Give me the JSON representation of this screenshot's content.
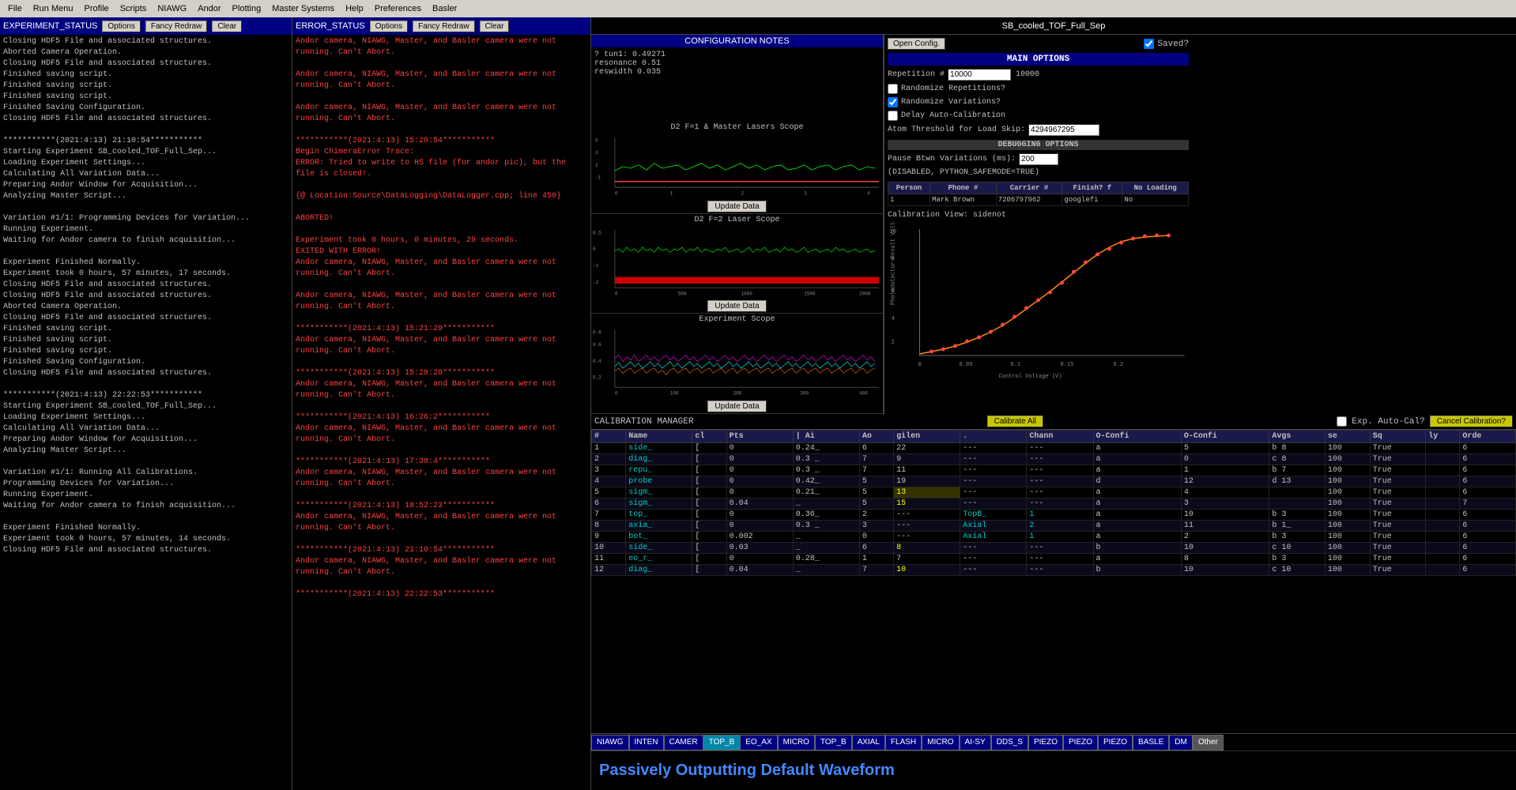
{
  "menubar": {
    "items": [
      "File",
      "Run Menu",
      "Profile",
      "Scripts",
      "NIAWG",
      "Andor",
      "Plotting",
      "Master Systems",
      "Help",
      "Preferences",
      "Basler"
    ]
  },
  "experiment_panel": {
    "title": "EXPERIMENT_STATUS",
    "options_btn": "Options",
    "fancy_btn": "Fancy Redraw",
    "clear_btn": "Clear",
    "logs": [
      {
        "text": "Closing HDF5 File and associated structures.",
        "cls": "normal"
      },
      {
        "text": "Aborted Camera Operation.",
        "cls": "normal"
      },
      {
        "text": "Closing HDF5 File and associated structures.",
        "cls": "normal"
      },
      {
        "text": "Finished saving script.",
        "cls": "normal"
      },
      {
        "text": "Finished saving script.",
        "cls": "normal"
      },
      {
        "text": "Finished saving script.",
        "cls": "normal"
      },
      {
        "text": "Finished Saving Configuration.",
        "cls": "normal"
      },
      {
        "text": "Closing HDF5 File and associated structures.",
        "cls": "normal"
      },
      {
        "text": "",
        "cls": "normal"
      },
      {
        "text": "***********(2021:4:13) 21:10:54***********",
        "cls": "normal"
      },
      {
        "text": "Starting Experiment SB_cooled_TOF_Full_Sep...",
        "cls": "normal"
      },
      {
        "text": "Loading Experiment Settings...",
        "cls": "normal"
      },
      {
        "text": "Calculating All Variation Data...",
        "cls": "normal"
      },
      {
        "text": "Preparing Andor Window for Acquisition...",
        "cls": "normal"
      },
      {
        "text": "Analyzing Master Script...",
        "cls": "normal"
      },
      {
        "text": "",
        "cls": "normal"
      },
      {
        "text": "Variation #1/1: Programming Devices for Variation...",
        "cls": "normal"
      },
      {
        "text": "Running Experiment.",
        "cls": "normal"
      },
      {
        "text": "Waiting for Andor camera to finish acquisition...",
        "cls": "normal"
      },
      {
        "text": "",
        "cls": "normal"
      },
      {
        "text": "Experiment Finished Normally.",
        "cls": "normal"
      },
      {
        "text": "Experiment took 0 hours, 57 minutes, 17 seconds.",
        "cls": "normal"
      },
      {
        "text": "Closing HDF5 File and associated structures.",
        "cls": "normal"
      },
      {
        "text": "Closing HDF5 File and associated structures.",
        "cls": "normal"
      },
      {
        "text": "Aborted Camera Operation.",
        "cls": "normal"
      },
      {
        "text": "Closing HDF5 File and associated structures.",
        "cls": "normal"
      },
      {
        "text": "Finished saving script.",
        "cls": "normal"
      },
      {
        "text": "Finished saving script.",
        "cls": "normal"
      },
      {
        "text": "Finished saving script.",
        "cls": "normal"
      },
      {
        "text": "Finished Saving Configuration.",
        "cls": "normal"
      },
      {
        "text": "Closing HDF5 File and associated structures.",
        "cls": "normal"
      },
      {
        "text": "",
        "cls": "normal"
      },
      {
        "text": "***********(2021:4:13) 22:22:53***********",
        "cls": "normal"
      },
      {
        "text": "Starting Experiment SB_cooled_TOF_Full_Sep...",
        "cls": "normal"
      },
      {
        "text": "Loading Experiment Settings...",
        "cls": "normal"
      },
      {
        "text": "Calculating All Variation Data...",
        "cls": "normal"
      },
      {
        "text": "Preparing Andor Window for Acquisition...",
        "cls": "normal"
      },
      {
        "text": "Analyzing Master Script...",
        "cls": "normal"
      },
      {
        "text": "",
        "cls": "normal"
      },
      {
        "text": "Variation #1/1: Running All Calibrations.",
        "cls": "normal"
      },
      {
        "text": "Programming Devices for Variation...",
        "cls": "normal"
      },
      {
        "text": "Running Experiment.",
        "cls": "normal"
      },
      {
        "text": "Waiting for Andor camera to finish acquisition...",
        "cls": "normal"
      },
      {
        "text": "",
        "cls": "normal"
      },
      {
        "text": "Experiment Finished Normally.",
        "cls": "normal"
      },
      {
        "text": "Experiment took 0 hours, 57 minutes, 14 seconds.",
        "cls": "normal"
      },
      {
        "text": "Closing HDF5 File and associated structures.",
        "cls": "normal"
      }
    ]
  },
  "error_panel": {
    "title": "ERROR_STATUS",
    "options_btn": "Options",
    "fancy_btn": "Fancy Redraw",
    "clear_btn": "Clear",
    "logs": [
      {
        "text": "Andor camera, NIAWG, Master, and Basler camera were not running. Can't Abort.",
        "cls": "error"
      },
      {
        "text": "",
        "cls": "normal"
      },
      {
        "text": "Andor camera, NIAWG, Master, and Basler camera were not running. Can't Abort.",
        "cls": "error"
      },
      {
        "text": "",
        "cls": "normal"
      },
      {
        "text": "Andor camera, NIAWG, Master, and Basler camera were not running. Can't Abort.",
        "cls": "error"
      },
      {
        "text": "",
        "cls": "normal"
      },
      {
        "text": "***********(2021:4:13) 15:20:54***********",
        "cls": "error"
      },
      {
        "text": "Begin ChimeraError Trace:",
        "cls": "error"
      },
      {
        "text": "ERROR: Tried to write to HS file (for andor pic), but the file is closed!.",
        "cls": "error"
      },
      {
        "text": "",
        "cls": "normal"
      },
      {
        "text": "{@ Location:Source\\DataLogging\\DataLogger.cpp; line 450}",
        "cls": "error"
      },
      {
        "text": "",
        "cls": "normal"
      },
      {
        "text": "ABORTED!",
        "cls": "error"
      },
      {
        "text": "",
        "cls": "normal"
      },
      {
        "text": "Experiment took 0 hours, 0 minutes, 29 seconds.",
        "cls": "error"
      },
      {
        "text": "EXITED WITH ERROR!",
        "cls": "error"
      },
      {
        "text": "Andor camera, NIAWG, Master, and Basler camera were not running. Can't Abort.",
        "cls": "error"
      },
      {
        "text": "",
        "cls": "normal"
      },
      {
        "text": "Andor camera, NIAWG, Master, and Basler camera were not running. Can't Abort.",
        "cls": "error"
      },
      {
        "text": "",
        "cls": "normal"
      },
      {
        "text": "***********(2021:4:13) 15:21:29***********",
        "cls": "error"
      },
      {
        "text": "Andor camera, NIAWG, Master, and Basler camera were not running. Can't Abort.",
        "cls": "error"
      },
      {
        "text": "",
        "cls": "normal"
      },
      {
        "text": "***********(2021:4:13) 15:28:28***********",
        "cls": "error"
      },
      {
        "text": "Andor camera, NIAWG, Master, and Basler camera were not running. Can't Abort.",
        "cls": "error"
      },
      {
        "text": "",
        "cls": "normal"
      },
      {
        "text": "***********(2021:4:13) 16:26:2***********",
        "cls": "error"
      },
      {
        "text": "Andor camera, NIAWG, Master, and Basler camera were not running. Can't Abort.",
        "cls": "error"
      },
      {
        "text": "",
        "cls": "normal"
      },
      {
        "text": "***********(2021:4:13) 17:38:4***********",
        "cls": "error"
      },
      {
        "text": "Andor camera, NIAWG, Master, and Basler camera were not running. Can't Abort.",
        "cls": "error"
      },
      {
        "text": "",
        "cls": "normal"
      },
      {
        "text": "***********(2021:4:13) 18:52:23***********",
        "cls": "error"
      },
      {
        "text": "Andor camera, NIAWG, Master, and Basler camera were not running. Can't Abort.",
        "cls": "error"
      },
      {
        "text": "",
        "cls": "normal"
      },
      {
        "text": "***********(2021:4:13) 21:10:54***********",
        "cls": "error"
      },
      {
        "text": "Andor camera, NIAWG, Master, and Basler camera were not running. Can't Abort.",
        "cls": "error"
      },
      {
        "text": "",
        "cls": "normal"
      },
      {
        "text": "***********(2021:4:13) 22:22:53***********",
        "cls": "error"
      }
    ]
  },
  "config_panel": {
    "title": "SB_cooled_TOF_Full_Sep",
    "notes_title": "CONFIGURATION NOTES",
    "notes": [
      "? tun1: 0.49271",
      "resonance 0.51",
      "reswidth 0.035"
    ],
    "plots": [
      {
        "title": "D2 F=1 & Master Lasers Scope",
        "update_btn": "Update Data"
      },
      {
        "title": "D2 F=2 Laser Scope",
        "update_btn": "Update Data"
      },
      {
        "title": "Experiment Scope",
        "update_btn": "Update Data"
      }
    ]
  },
  "options_panel": {
    "title": "MAIN OPTIONS",
    "open_config_btn": "Open Config.",
    "saved_label": "Saved?",
    "repetition_label": "Repetition #",
    "repetition_value": "10000",
    "repetition_display": "10000",
    "randomize_reps": "Randomize Repetitions?",
    "randomize_reps_checked": false,
    "randomize_vars": "Randomize Variations?",
    "randomize_vars_checked": true,
    "delay_autocal": "Delay Auto-Calibration",
    "delay_autocal_checked": false,
    "atom_threshold_label": "Atom Threshold for Load Skip:",
    "atom_threshold_value": "4294967295",
    "debug_title": "DEBUGGING OPTIONS",
    "pause_btwn_label": "Pause Btwn Variations (ms):",
    "pause_btwn_value": "200",
    "python_mode": "(DISABLED, PYTHON_SAFEMODE=TRUE)",
    "loading_table": {
      "headers": [
        "Person",
        "Phone #",
        "Carrier #",
        "Finish? f",
        "No Loading"
      ],
      "rows": [
        [
          "1",
          "Mark Brown",
          "7206797962",
          "googlefi",
          "No",
          "",
          "No"
        ]
      ]
    },
    "cal_view_label": "Calibration View: sidenot",
    "exp_autocal_label": "Exp. Auto-Cal?",
    "cancel_cal_btn": "Cancel Calibration?"
  },
  "calibration": {
    "manager_title": "CALIBRATION MANAGER",
    "calibrate_all_btn": "Calibrate All",
    "headers": [
      "#",
      "Name",
      "cl",
      "Pts",
      "| Ai",
      "Ao",
      "gilen",
      ".",
      "Chann",
      "O-Confi",
      "O-Confi",
      "Avgs",
      "se",
      "Sq",
      "ly",
      "Orde"
    ],
    "rows": [
      {
        "num": "1",
        "name": "side_",
        "cl": "[",
        "pts": "0",
        "ai": "0.24_",
        "ao": "6",
        "other": "22",
        "dash1": "---",
        "dash2": "---",
        "chan": "a",
        "o1": "5",
        "o2": "b 8",
        "avgs": "100",
        "true1": "True",
        "val": "6"
      },
      {
        "num": "2",
        "name": "diag_",
        "cl": "[",
        "pts": "0",
        "ai": "0.3 _",
        "ao": "7",
        "other": "9",
        "dash1": "---",
        "dash2": "---",
        "chan": "a",
        "o1": "0",
        "o2": "c 8",
        "avgs": "100",
        "true1": "True",
        "val": "6"
      },
      {
        "num": "3",
        "name": "repu_",
        "cl": "[",
        "pts": "0",
        "ai": "0.3 _",
        "ao": "7",
        "other": "11",
        "dash1": "---",
        "dash2": "---",
        "chan": "a",
        "o1": "1",
        "o2": "b 7",
        "avgs": "100",
        "true1": "True",
        "val": "6"
      },
      {
        "num": "4",
        "name": "probe",
        "cl": "[",
        "pts": "0",
        "ai": "0.42_",
        "ao": "5",
        "other": "19",
        "dash1": "---",
        "dash2": "---",
        "chan": "d",
        "o1": "12",
        "o2": "d 13",
        "avgs": "100",
        "true1": "True",
        "val": "6"
      },
      {
        "num": "5",
        "name": "sigm_",
        "cl": "[",
        "pts": "0",
        "ai": "0.21_",
        "ao": "5",
        "other": "13",
        "dash1": "---",
        "dash2": "---",
        "chan": "a",
        "o1": "4",
        "o2": "",
        "avgs": "100",
        "true1": "True",
        "val": "6"
      },
      {
        "num": "6",
        "name": "sigm_",
        "cl": "[",
        "pts": "0.04",
        "ai": "_",
        "ao": "5",
        "other": "15",
        "dash1": "---",
        "dash2": "---",
        "chan": "a",
        "o1": "3",
        "o2": "",
        "avgs": "100",
        "true1": "True",
        "val": "7"
      },
      {
        "num": "7",
        "name": "top_",
        "cl": "[",
        "pts": "0",
        "ai": "0.36_",
        "ao": "2",
        "other": "---",
        "dash1": "TopB_",
        "dash2": "1",
        "chan": "a",
        "o1": "10",
        "o2": "b 3",
        "avgs": "100",
        "true1": "True",
        "val": "6"
      },
      {
        "num": "8",
        "name": "axia_",
        "cl": "[",
        "pts": "0",
        "ai": "0.3 _",
        "ao": "3",
        "other": "---",
        "dash1": "Axial",
        "dash2": "2",
        "chan": "a",
        "o1": "11",
        "o2": "b 1_",
        "avgs": "100",
        "true1": "True",
        "val": "6"
      },
      {
        "num": "9",
        "name": "bot_",
        "cl": "[",
        "pts": "0.002",
        "ai": "_",
        "ao": "0",
        "other": "---",
        "dash1": "Axial",
        "dash2": "1",
        "chan": "a",
        "o1": "2",
        "o2": "b 3",
        "avgs": "100",
        "true1": "True",
        "val": "6"
      },
      {
        "num": "10",
        "name": "side_",
        "cl": "[",
        "pts": "0.03",
        "ai": "_",
        "ao": "6",
        "other": "8",
        "dash1": "---",
        "dash2": "---",
        "chan": "b",
        "o1": "10",
        "o2": "c 10",
        "avgs": "100",
        "true1": "True",
        "val": "6"
      },
      {
        "num": "11",
        "name": "eo_r_",
        "cl": "[",
        "pts": "0",
        "ai": "0.28_",
        "ao": "1",
        "other": "7",
        "dash1": "---",
        "dash2": "---",
        "chan": "a",
        "o1": "8",
        "o2": "b 3",
        "avgs": "100",
        "true1": "True",
        "val": "6"
      },
      {
        "num": "12",
        "name": "diag_",
        "cl": "[",
        "pts": "0.04",
        "ai": "_",
        "ao": "7",
        "other": "10",
        "dash1": "---",
        "dash2": "---",
        "chan": "b",
        "o1": "10",
        "o2": "c 10",
        "avgs": "100",
        "true1": "True",
        "val": "6"
      }
    ]
  },
  "bottom_tabs": {
    "tabs": [
      "NIAWG",
      "INTEN",
      "CAMER",
      "TOP_B",
      "EO_AX",
      "MICRO",
      "TOP_B",
      "AXIAL",
      "FLASH",
      "MICRO",
      "AI-SY",
      "DDS_S",
      "PIEZO",
      "PIEZO",
      "PIEZO",
      "BASLE",
      "DM",
      "Other"
    ]
  },
  "waveform": {
    "title": "Passively Outputting Default Waveform"
  }
}
